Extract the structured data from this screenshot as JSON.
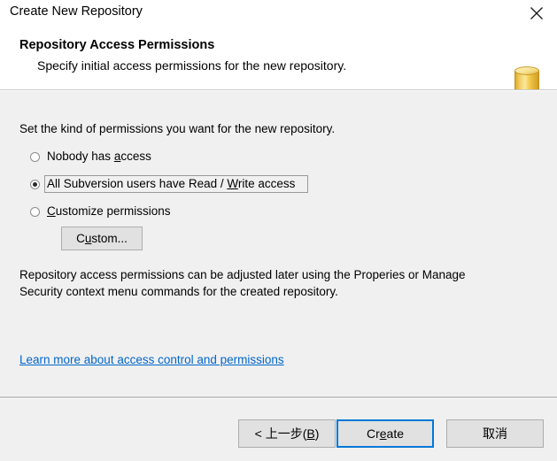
{
  "window": {
    "title": "Create New Repository",
    "close_icon": "close-icon"
  },
  "header": {
    "title": "Repository Access Permissions",
    "subtitle": "Specify initial access permissions for the new repository.",
    "icon": "database-cylinder-icon"
  },
  "body": {
    "intro": "Set the kind of permissions you want for the new repository.",
    "options": [
      {
        "pre": "Nobody has ",
        "accel": "a",
        "post": "ccess",
        "checked": false,
        "focused": false
      },
      {
        "pre": "All Subversion users have Read / ",
        "accel": "W",
        "post": "rite access",
        "checked": true,
        "focused": true
      },
      {
        "pre": "",
        "accel": "C",
        "post": "ustomize permissions",
        "checked": false,
        "focused": false
      }
    ],
    "custom_button": {
      "pre": "C",
      "accel": "u",
      "post": "stom..."
    },
    "note": "Repository access permissions can be adjusted later using the Properies or Manage Security context menu commands for the created repository.",
    "link": "Learn more about access control and permissions"
  },
  "footer": {
    "back": {
      "pre": "< 上一步(",
      "accel": "B",
      "post": ")"
    },
    "create": {
      "pre": "Cr",
      "accel": "e",
      "post": "ate"
    },
    "cancel": {
      "pre": "取消",
      "accel": "",
      "post": ""
    }
  },
  "colors": {
    "accent": "#0078d7",
    "link": "#0066cc",
    "body_bg": "#f0f0f0",
    "header_bg": "#ffffff",
    "button_bg": "#e1e1e1",
    "icon_gold": "#e8b53a"
  }
}
